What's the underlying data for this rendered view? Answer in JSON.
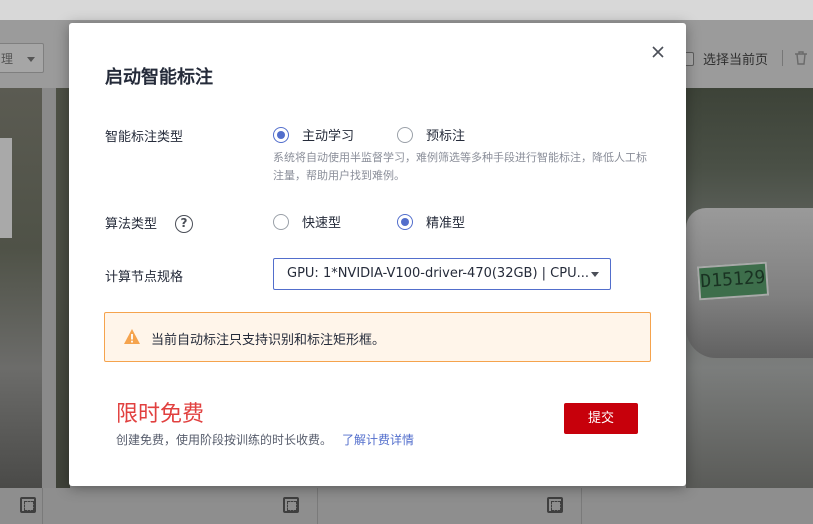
{
  "background": {
    "select_value": "理",
    "select_current_page_label": "选择当前页",
    "plate_text": "D15129"
  },
  "modal": {
    "title": "启动智能标注",
    "annotation_type": {
      "label": "智能标注类型",
      "options": [
        {
          "label": "主动学习",
          "selected": true
        },
        {
          "label": "预标注",
          "selected": false
        }
      ],
      "hint": "系统将自动使用半监督学习，难例筛选等多种手段进行智能标注，降低人工标注量，帮助用户找到难例。"
    },
    "algorithm_type": {
      "label": "算法类型",
      "help_icon_text": "?",
      "options": [
        {
          "label": "快速型",
          "selected": false
        },
        {
          "label": "精准型",
          "selected": true
        }
      ]
    },
    "compute_spec": {
      "label": "计算节点规格",
      "value": "GPU: 1*NVIDIA-V100-driver-470(32GB) | CPU..."
    },
    "warning": "当前自动标注只支持识别和标注矩形框。",
    "promo": {
      "title": "限时免费",
      "desc": "创建免费，使用阶段按训练的时长收费。",
      "link": "了解计费详情"
    },
    "submit_label": "提交"
  },
  "colors": {
    "accent": "#526ecc",
    "submit": "#c7000b",
    "promo": "#e1403f",
    "warning_border": "#f5a34d",
    "warning_bg": "#fff5ea"
  }
}
